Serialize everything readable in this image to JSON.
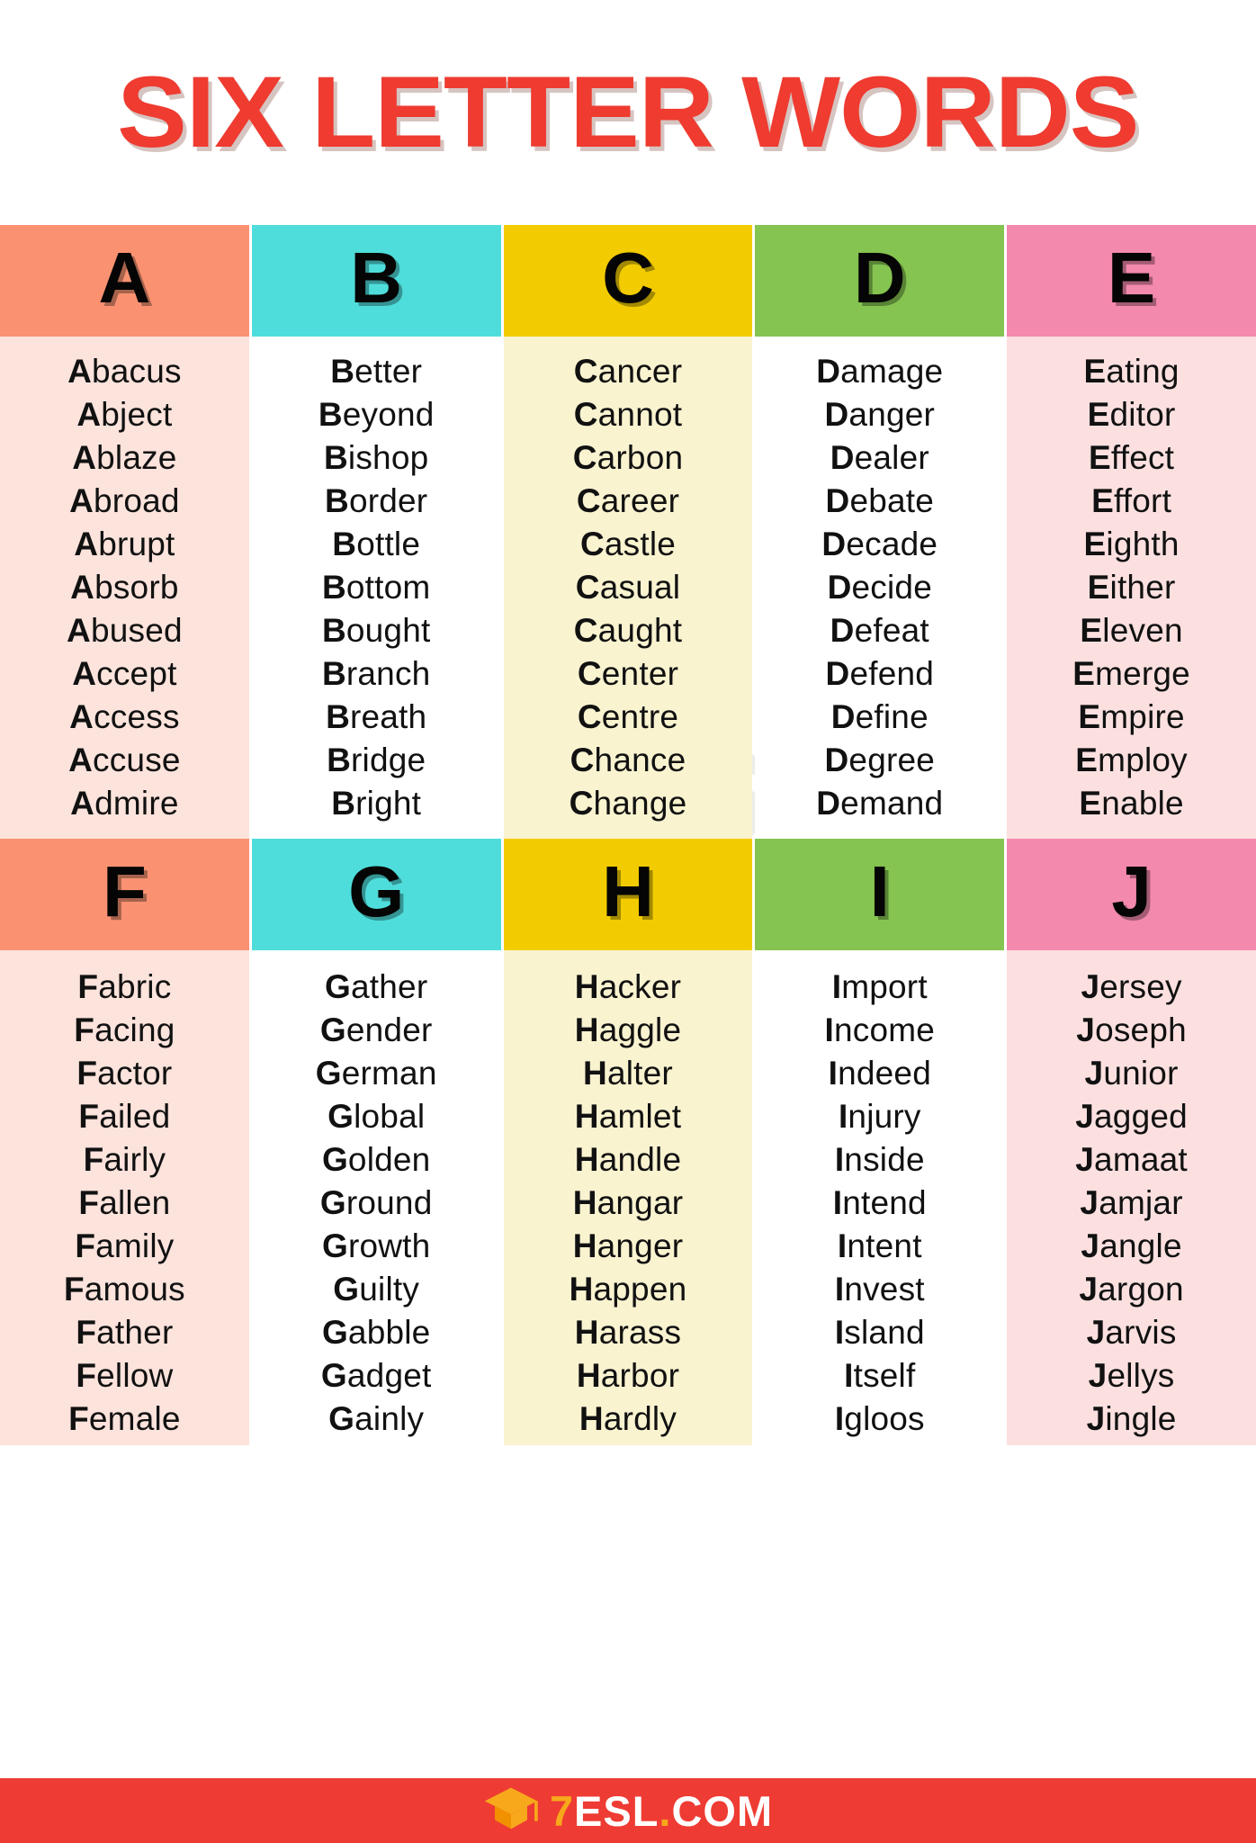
{
  "title": "SIX LETTER WORDS",
  "colors": {
    "title_red": "#ef3b30",
    "footer_red": "#ee3b33",
    "header_salmon": "#fa9272",
    "header_turquoise": "#4fdddb",
    "header_yellow": "#f2cc00",
    "header_green": "#85c450",
    "header_pink": "#f489ae",
    "body_pink_light": "#fce3dc",
    "body_white": "#ffffff",
    "body_cream": "#faf3d0",
    "body_rose": "#fce0e0",
    "brand_orange": "#f7a81b"
  },
  "sections": [
    {
      "columns": [
        {
          "letter": "A",
          "header_color": "#fa9272",
          "body_color": "#fce3dc",
          "words": [
            "Abacus",
            "Abject",
            "Ablaze",
            "Abroad",
            "Abrupt",
            "Absorb",
            "Abused",
            "Accept",
            "Access",
            "Accuse",
            "Admire"
          ]
        },
        {
          "letter": "B",
          "header_color": "#4fdddb",
          "body_color": "#ffffff",
          "words": [
            "Better",
            "Beyond",
            "Bishop",
            "Border",
            "Bottle",
            "Bottom",
            "Bought",
            "Branch",
            "Breath",
            "Bridge",
            "Bright"
          ]
        },
        {
          "letter": "C",
          "header_color": "#f2cc00",
          "body_color": "#faf3d0",
          "words": [
            "Cancer",
            "Cannot",
            "Carbon",
            "Career",
            "Castle",
            "Casual",
            "Caught",
            "Center",
            "Centre",
            "Chance",
            "Change"
          ]
        },
        {
          "letter": "D",
          "header_color": "#85c450",
          "body_color": "#ffffff",
          "words": [
            "Damage",
            "Danger",
            "Dealer",
            "Debate",
            "Decade",
            "Decide",
            "Defeat",
            "Defend",
            "Define",
            "Degree",
            "Demand"
          ]
        },
        {
          "letter": "E",
          "header_color": "#f489ae",
          "body_color": "#fce0e0",
          "words": [
            "Eating",
            "Editor",
            "Effect",
            "Effort",
            "Eighth",
            "Either",
            "Eleven",
            "Emerge",
            "Empire",
            "Employ",
            "Enable"
          ]
        }
      ]
    },
    {
      "columns": [
        {
          "letter": "F",
          "header_color": "#fa9272",
          "body_color": "#fce3dc",
          "words": [
            "Fabric",
            "Facing",
            "Factor",
            "Failed",
            "Fairly",
            "Fallen",
            "Family",
            "Famous",
            "Father",
            "Fellow",
            "Female"
          ]
        },
        {
          "letter": "G",
          "header_color": "#4fdddb",
          "body_color": "#ffffff",
          "words": [
            "Gather",
            "Gender",
            "German",
            "Global",
            "Golden",
            "Ground",
            "Growth",
            "Guilty",
            "Gabble",
            "Gadget",
            "Gainly"
          ]
        },
        {
          "letter": "H",
          "header_color": "#f2cc00",
          "body_color": "#faf3d0",
          "words": [
            "Hacker",
            "Haggle",
            "Halter",
            "Hamlet",
            "Handle",
            "Hangar",
            "Hanger",
            "Happen",
            "Harass",
            "Harbor",
            "Hardly"
          ]
        },
        {
          "letter": "I",
          "header_color": "#85c450",
          "body_color": "#ffffff",
          "words": [
            "Import",
            "Income",
            "Indeed",
            "Injury",
            "Inside",
            "Intend",
            "Intent",
            "Invest",
            "Island",
            "Itself",
            "Igloos"
          ]
        },
        {
          "letter": "J",
          "header_color": "#f489ae",
          "body_color": "#fce0e0",
          "words": [
            "Jersey",
            "Joseph",
            "Junior",
            "Jagged",
            "Jamaat",
            "Jamjar",
            "Jangle",
            "Jargon",
            "Jarvis",
            "Jellys",
            "Jingle"
          ]
        }
      ]
    }
  ],
  "footer": {
    "brand_seven": "7",
    "brand_rest": "ESL",
    "brand_dot": ".",
    "brand_tld": "COM",
    "icon": "graduation-cap-icon"
  },
  "watermark": {
    "text": "7ESL.COM",
    "icon": "graduation-cap-icon"
  }
}
